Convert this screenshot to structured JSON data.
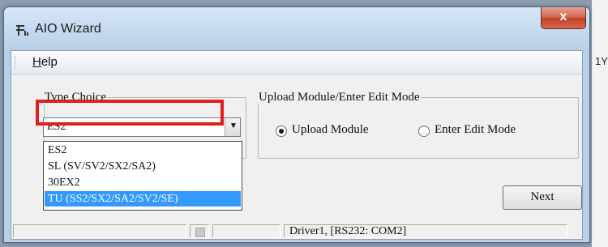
{
  "window": {
    "title": "AIO Wizard",
    "close_label": "x"
  },
  "menu": {
    "help_accel": "H",
    "help_rest": "elp"
  },
  "type_choice": {
    "legend": "Type Choice",
    "selected": "ES2",
    "options": [
      "ES2",
      "SL (SV/SV2/SX2/SA2)",
      "30EX2",
      "TU (SS2/SX2/SA2/SV2/SE)"
    ],
    "highlighted_index": 3
  },
  "upload": {
    "legend": "Upload Module/Enter Edit Mode",
    "option_upload": "Upload Module",
    "option_edit": "Enter Edit Mode",
    "selected": "Upload Module"
  },
  "buttons": {
    "next": "Next"
  },
  "status": {
    "driver": "Driver1, [RS232: COM2]"
  },
  "colors": {
    "accent_selection": "#3399ff",
    "annotation_red": "#e0201e",
    "close_button": "#c2432a"
  },
  "background": {
    "right_fragment": "1Y"
  }
}
